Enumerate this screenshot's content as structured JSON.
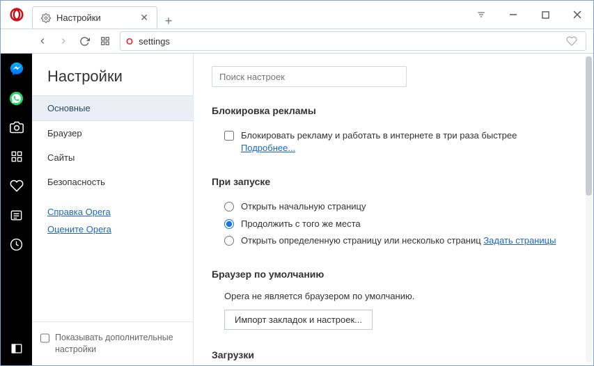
{
  "titlebar": {
    "tab_title": "Настройки",
    "new_tab": "+"
  },
  "toolbar": {
    "address_badge": "O",
    "address_value": "settings"
  },
  "sidebar": {
    "heading": "Настройки",
    "items": [
      {
        "label": "Основные",
        "active": true
      },
      {
        "label": "Браузер",
        "active": false
      },
      {
        "label": "Сайты",
        "active": false
      },
      {
        "label": "Безопасность",
        "active": false
      }
    ],
    "help_link": "Справка Opera",
    "rate_link": "Оцените Opera",
    "advanced_label": "Показывать дополнительные настройки"
  },
  "content": {
    "search_placeholder": "Поиск настроек",
    "adblock": {
      "title": "Блокировка рекламы",
      "checkbox_label": "Блокировать рекламу и работать в интернете в три раза быстрее",
      "learn_more": "Подробнее..."
    },
    "startup": {
      "title": "При запуске",
      "opt1": "Открыть начальную страницу",
      "opt2": "Продолжить с того же места",
      "opt3": "Открыть определенную страницу или несколько страниц",
      "opt3_link": "Задать страницы"
    },
    "default_browser": {
      "title": "Браузер по умолчанию",
      "status": "Opera не является браузером по умолчанию.",
      "import_btn": "Импорт закладок и настроек..."
    },
    "downloads": {
      "title": "Загрузки"
    }
  }
}
